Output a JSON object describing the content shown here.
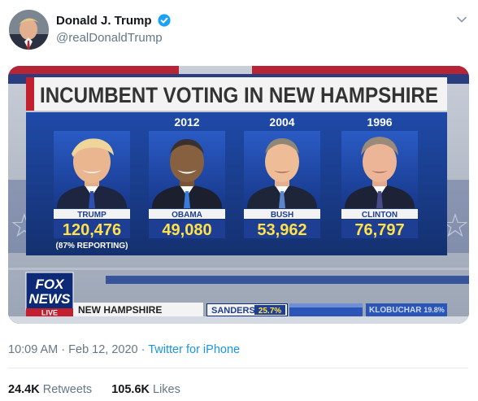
{
  "tweet": {
    "author_name": "Donald J. Trump",
    "author_handle": "@realDonaldTrump",
    "time": "10:09 AM",
    "dot_sep": " · ",
    "date": "Feb 12, 2020",
    "source": "Twitter for iPhone"
  },
  "stats": {
    "retweets_count": "24.4K",
    "retweets_label": "Retweets",
    "likes_count": "105.6K",
    "likes_label": "Likes"
  },
  "graphic": {
    "title": "INCUMBENT VOTING IN NEW HAMPSHIRE",
    "candidates": [
      {
        "year": "",
        "name": "TRUMP",
        "votes": "120,476",
        "note": "(87% REPORTING)"
      },
      {
        "year": "2012",
        "name": "OBAMA",
        "votes": "49,080"
      },
      {
        "year": "2004",
        "name": "BUSH",
        "votes": "53,962"
      },
      {
        "year": "1996",
        "name": "CLINTON",
        "votes": "76,797"
      }
    ],
    "logo_line1": "FOX",
    "logo_line2": "NEWS",
    "logo_live": "LIVE",
    "ticker_state": "NEW HAMPSHIRE",
    "ticker_sanders": "SANDERS",
    "ticker_sanders_pct": "25.7%",
    "ticker_klobuchar": "KLOBUCHAR",
    "ticker_klobuchar_pct": "19.8%"
  },
  "colors": {
    "verified": "#1da1f2",
    "link": "#1b95e0",
    "panel_blue": "#1d3e93",
    "votes_yellow": "#ffe24a",
    "title_bg": "#f2f2f2"
  }
}
